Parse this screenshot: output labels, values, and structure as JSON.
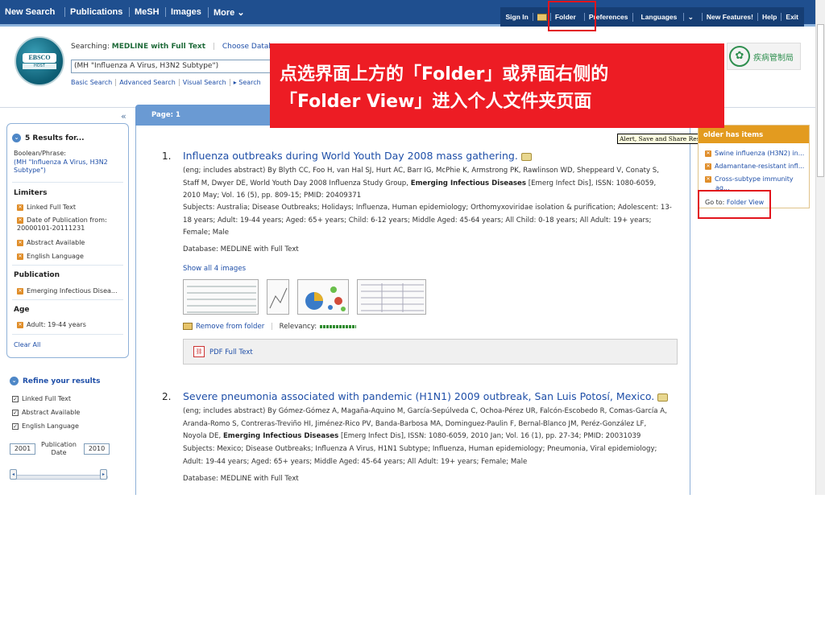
{
  "topnav": {
    "new_search": "New Search",
    "publications": "Publications",
    "mesh": "MeSH",
    "images": "Images",
    "more": "More",
    "more_arrow": "⌄"
  },
  "rightnav": {
    "sign_in": "Sign In",
    "folder": "Folder",
    "preferences": "Preferences",
    "languages": "Languages",
    "new_features": "New Features!",
    "help": "Help",
    "exit": "Exit"
  },
  "logo": {
    "top": "EBSCO",
    "bottom": "HOST"
  },
  "search": {
    "searching_label": "Searching:",
    "database": "MEDLINE with Full Text",
    "choose_db": "Choose Datab",
    "query": "(MH \"Influenza A Virus, H3N2 Subtype\")",
    "links": [
      "Basic Search",
      "Advanced Search",
      "Visual Search",
      "▸ Search"
    ]
  },
  "cdc_text": "疾病管制局",
  "collapse_glyph": "«",
  "left": {
    "results_for": "5 Results for...",
    "bool_label": "Boolean/Phrase:",
    "bool_value": "(MH \"Influenza A Virus, H3N2 Subtype\")",
    "limiters_head": "Limiters",
    "limiters": [
      "Linked Full Text",
      "Date of Publication from: 20000101-20111231",
      "Abstract Available",
      "English Language"
    ],
    "publication_head": "Publication",
    "publication": "Emerging Infectious Disea...",
    "age_head": "Age",
    "age": "Adult: 19-44 years",
    "clear_all": "Clear All",
    "refine_head": "Refine your results",
    "refine_checks": [
      "Linked Full Text",
      "Abstract Available",
      "English Language"
    ],
    "year_from": "2001",
    "year_to": "2010",
    "pub_date_label": "Publication Date"
  },
  "page_label": "Page: 1",
  "results": [
    {
      "num": "1.",
      "title": "Influenza outbreaks during World Youth Day 2008 mass gathering.",
      "lines": [
        "(eng; includes abstract) By Blyth CC, Foo H, van Hal SJ, Hurt AC, Barr IG, McPhie K, Armstrong PK, Rawlinson WD, Sheppeard V, Conaty S,",
        "Staff M, Dwyer DE, World Youth Day 2008 Influenza Study Group,",
        "Emerging Infectious Diseases",
        "[Emerg Infect Dis], ISSN: 1080-6059,",
        "2010 May; Vol. 16 (5), pp. 809-15; PMID: 20409371"
      ],
      "subjects": [
        "Subjects: Australia; Disease Outbreaks; Holidays; Influenza, Human epidemiology; Orthomyxoviridae isolation & purification; Adolescent: 13-",
        "18 years; Adult: 19-44 years; Aged: 65+ years; Child: 6-12 years; Middle Aged: 45-64 years; All Child: 0-18 years; All Adult: 19+ years;",
        "Female; Male"
      ],
      "database": "Database: MEDLINE with Full Text",
      "show_images": "Show all 4 images",
      "remove_folder": "Remove from folder",
      "relevancy": "Relevancy:",
      "pdf": "PDF Full Text"
    },
    {
      "num": "2.",
      "title": "Severe pneumonia associated with pandemic (H1N1) 2009 outbreak, San Luis Potosí, Mexico.",
      "lines": [
        "(eng; includes abstract) By Gómez-Gómez A, Magaña-Aquino M, García-Sepúlveda C, Ochoa-Pérez UR, Falcón-Escobedo R, Comas-García A,",
        "Aranda-Romo S, Contreras-Treviño HI, Jiménez-Rico PV, Banda-Barbosa MA, Dominguez-Paulin F, Bernal-Blanco JM, Peréz-González LF,",
        "Noyola DE,",
        "Emerging Infectious Diseases",
        "[Emerg Infect Dis], ISSN: 1080-6059, 2010 Jan; Vol. 16 (1), pp. 27-34; PMID: 20031039"
      ],
      "subjects": [
        "Subjects: Mexico; Disease Outbreaks; Influenza A Virus, H1N1 Subtype; Influenza, Human epidemiology; Pneumonia, Viral epidemiology;",
        "Adult: 19-44 years; Aged: 65+ years; Middle Aged: 45-64 years; All Adult: 19+ years; Female; Male"
      ],
      "database": "Database: MEDLINE with Full Text"
    }
  ],
  "tooltip": "Alert, Save and Share Results",
  "folder": {
    "head": "older has items",
    "items": [
      "Swine influenza (H3N2) in...",
      "Adamantane-resistant infl...",
      "Cross-subtype immunity",
      "ag..."
    ],
    "goto_label": "Go to:",
    "goto_link": "Folder View"
  },
  "callout": {
    "line1": "点选界面上方的「Folder」或界面右侧的",
    "line2": "「Folder View」进入个人文件夹页面"
  },
  "colors": {
    "nav_bg": "#1f4f8f",
    "accent_orange": "#e39b1f",
    "callout_red": "#ed1c24",
    "link_blue": "#1f4fa8"
  }
}
